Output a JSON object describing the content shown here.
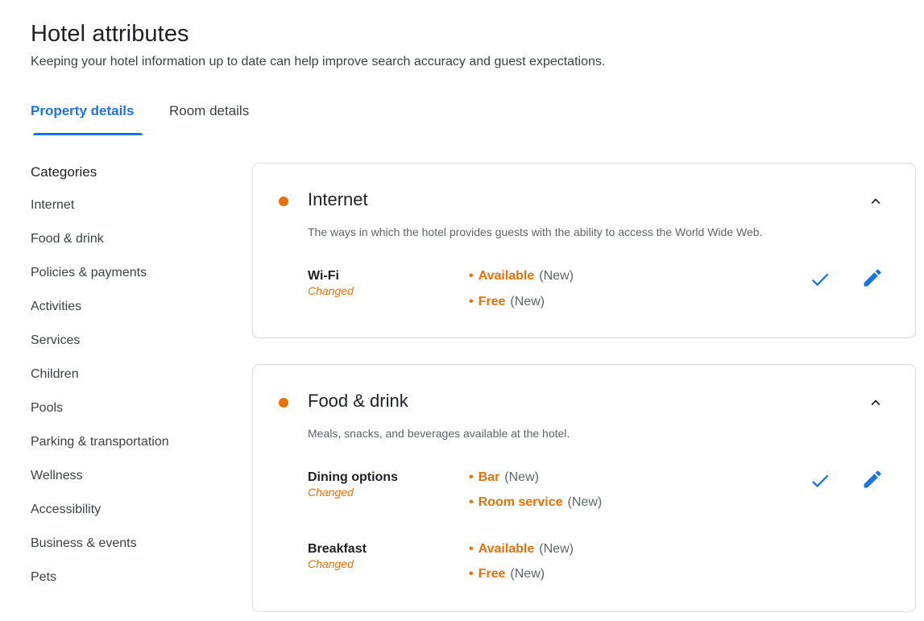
{
  "header": {
    "title": "Hotel attributes",
    "subtitle": "Keeping your hotel information up to date can help improve search accuracy and guest expectations."
  },
  "tabs": [
    {
      "label": "Property details",
      "active": true
    },
    {
      "label": "Room details",
      "active": false
    }
  ],
  "sidebar": {
    "heading": "Categories",
    "items": [
      {
        "label": "Internet"
      },
      {
        "label": "Food & drink"
      },
      {
        "label": "Policies & payments"
      },
      {
        "label": "Activities"
      },
      {
        "label": "Services"
      },
      {
        "label": "Children"
      },
      {
        "label": "Pools"
      },
      {
        "label": "Parking & transportation"
      },
      {
        "label": "Wellness"
      },
      {
        "label": "Accessibility"
      },
      {
        "label": "Business & events"
      },
      {
        "label": "Pets"
      }
    ]
  },
  "sections": [
    {
      "title": "Internet",
      "description": "The ways in which the hotel provides guests with the ability to access the World Wide Web.",
      "attributes": [
        {
          "name": "Wi-Fi",
          "status": "Changed",
          "values": [
            {
              "label": "Available",
              "tag": "(New)"
            },
            {
              "label": "Free",
              "tag": "(New)"
            }
          ]
        }
      ]
    },
    {
      "title": "Food & drink",
      "description": "Meals, snacks, and beverages available at the hotel.",
      "attributes": [
        {
          "name": "Dining options",
          "status": "Changed",
          "values": [
            {
              "label": "Bar",
              "tag": "(New)"
            },
            {
              "label": "Room service",
              "tag": "(New)"
            }
          ]
        },
        {
          "name": "Breakfast",
          "status": "Changed",
          "values": [
            {
              "label": "Available",
              "tag": "(New)"
            },
            {
              "label": "Free",
              "tag": "(New)"
            }
          ]
        }
      ]
    }
  ],
  "colors": {
    "accent": "#1a73e8",
    "changed": "#e8710a",
    "border": "#dadce0"
  },
  "icons": {
    "collapse": "chevron-up-icon",
    "accept": "check-icon",
    "edit": "pencil-icon",
    "status": "orange-dot-icon"
  }
}
